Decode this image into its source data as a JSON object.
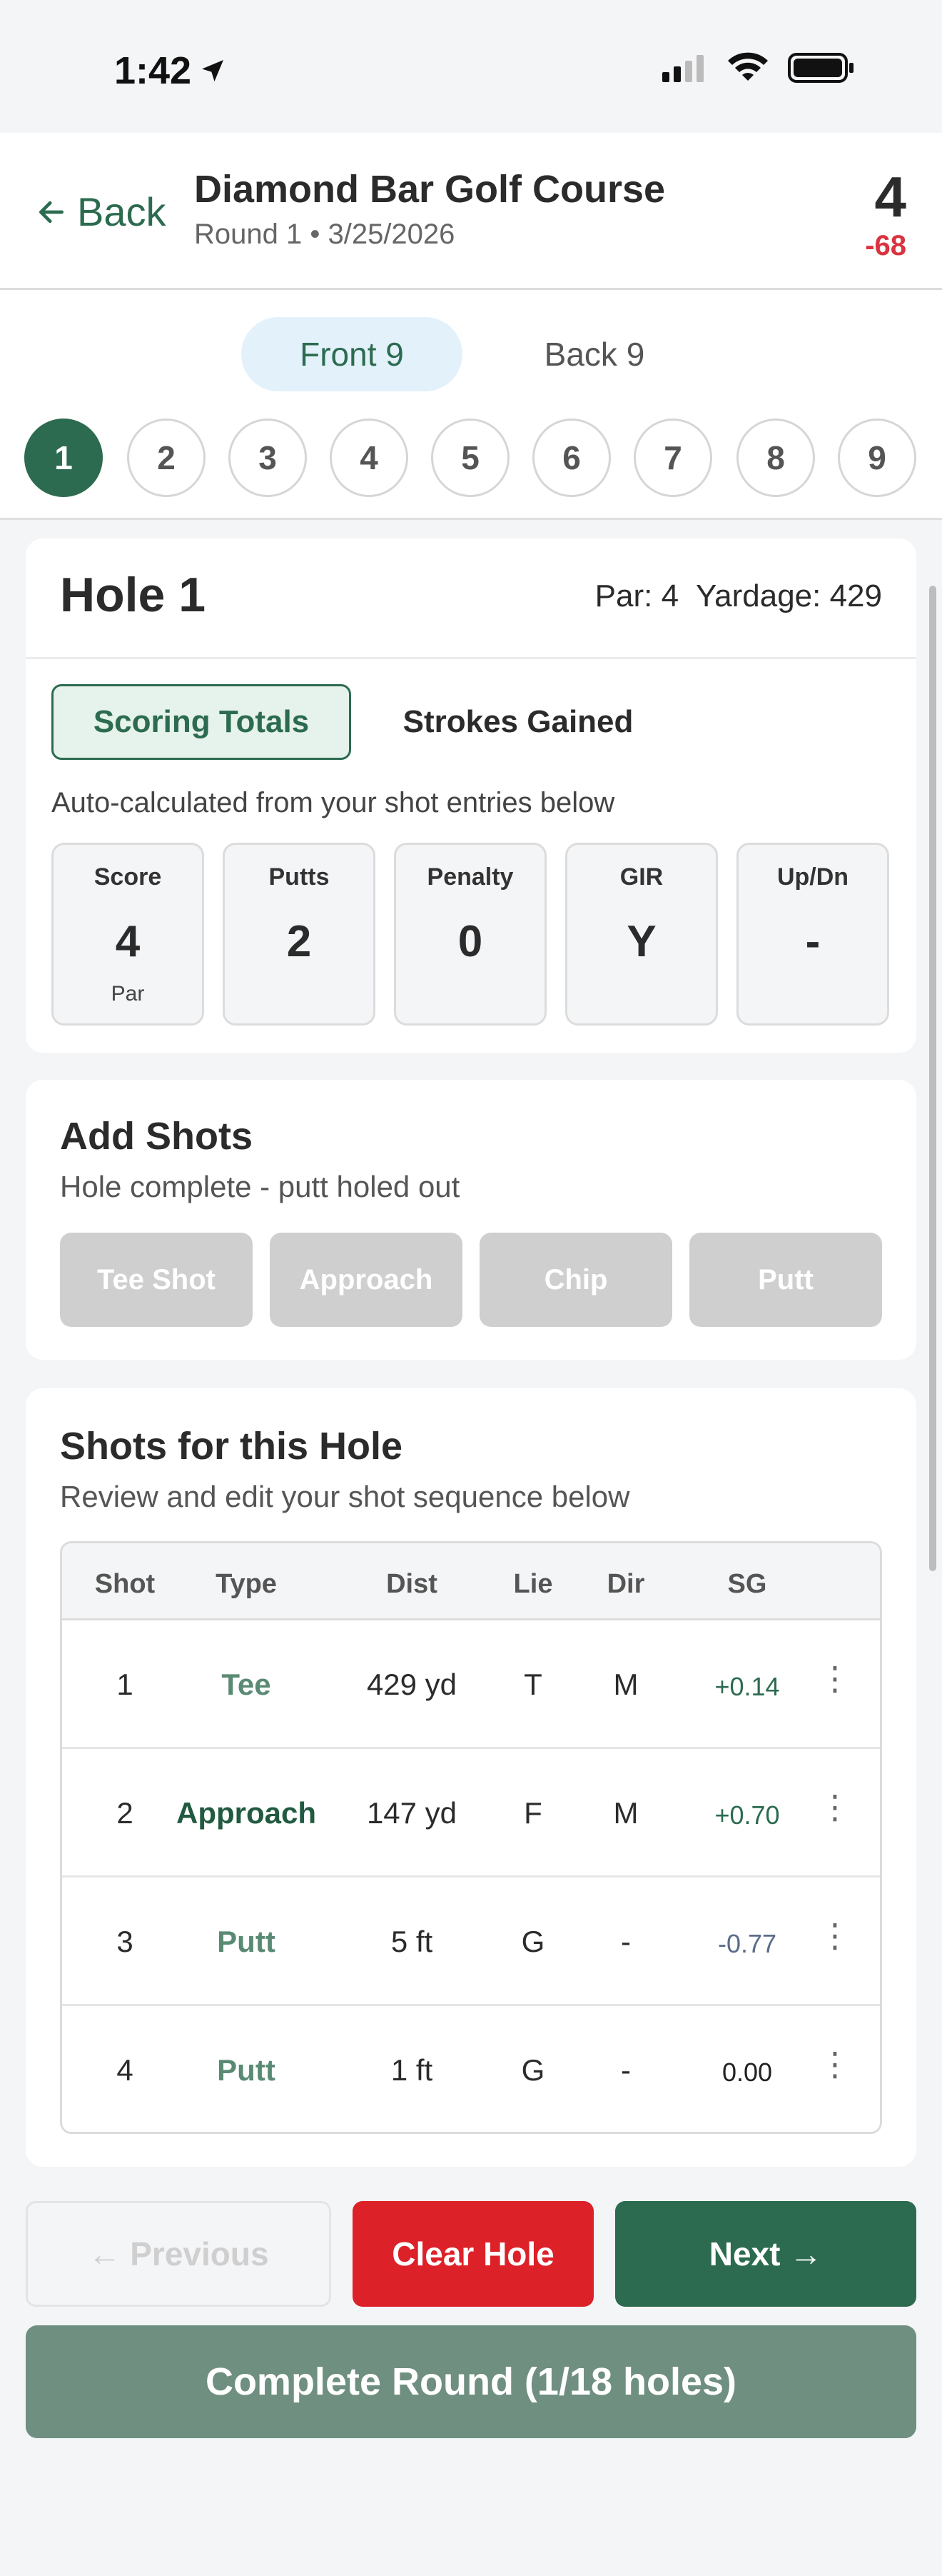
{
  "status_bar": {
    "time": "1:42"
  },
  "header": {
    "back_label": "Back",
    "course_name": "Diamond Bar Golf Course",
    "round_info": "Round 1 • 3/25/2026",
    "total_score": "4",
    "to_par": "-68"
  },
  "nine_tabs": {
    "front": "Front 9",
    "back": "Back 9",
    "active": "Front 9"
  },
  "holes": [
    "1",
    "2",
    "3",
    "4",
    "5",
    "6",
    "7",
    "8",
    "9"
  ],
  "active_hole": "1",
  "hole": {
    "title": "Hole 1",
    "par": "Par: 4",
    "yardage": "Yardage: 429",
    "tabs": {
      "scoring": "Scoring Totals",
      "strokes_gained": "Strokes Gained"
    },
    "auto_note": "Auto-calculated from your shot entries below",
    "stats": [
      {
        "label": "Score",
        "value": "4",
        "sub": "Par"
      },
      {
        "label": "Putts",
        "value": "2",
        "sub": ""
      },
      {
        "label": "Penalty",
        "value": "0",
        "sub": ""
      },
      {
        "label": "GIR",
        "value": "Y",
        "sub": ""
      },
      {
        "label": "Up/Dn",
        "value": "-",
        "sub": ""
      }
    ]
  },
  "add_shots": {
    "title": "Add Shots",
    "subtitle": "Hole complete - putt holed out",
    "buttons": [
      "Tee Shot",
      "Approach",
      "Chip",
      "Putt"
    ]
  },
  "shots": {
    "title": "Shots for this Hole",
    "subtitle": "Review and edit your shot sequence below",
    "columns": [
      "Shot",
      "Type",
      "Dist",
      "Lie",
      "Dir",
      "SG"
    ],
    "rows": [
      {
        "shot": "1",
        "type": "Tee",
        "dist": "429 yd",
        "lie": "T",
        "dir": "M",
        "sg": "+0.14"
      },
      {
        "shot": "2",
        "type": "Approach",
        "dist": "147 yd",
        "lie": "F",
        "dir": "M",
        "sg": "+0.70"
      },
      {
        "shot": "3",
        "type": "Putt",
        "dist": "5 ft",
        "lie": "G",
        "dir": "-",
        "sg": "-0.77"
      },
      {
        "shot": "4",
        "type": "Putt",
        "dist": "1 ft",
        "lie": "G",
        "dir": "-",
        "sg": "0.00"
      }
    ]
  },
  "footer": {
    "previous": "← Previous",
    "clear": "Clear Hole",
    "next": "Next →",
    "complete": "Complete Round (1/18 holes)"
  },
  "colors": {
    "brand_green": "#2c6b4f",
    "danger_red": "#dd2128",
    "to_par_red": "#d9333f"
  }
}
